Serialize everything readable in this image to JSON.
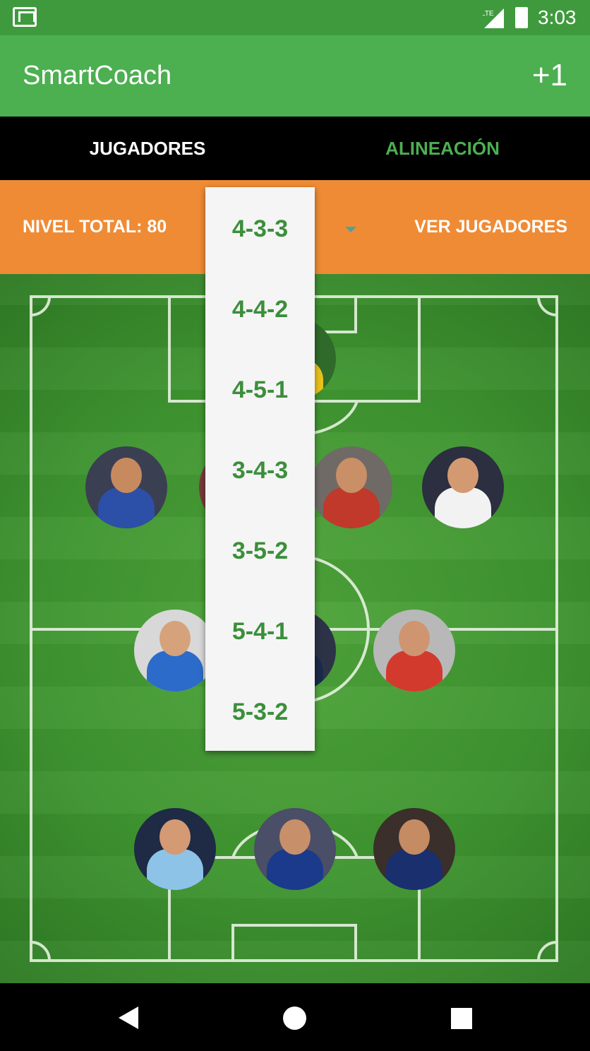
{
  "status_bar": {
    "time": "3:03",
    "network": "LTE",
    "icons": [
      "gmail-icon",
      "signal-icon",
      "battery-charging-icon"
    ]
  },
  "app_bar": {
    "title": "SmartCoach",
    "action_label": "+1"
  },
  "tabs": [
    {
      "label": "JUGADORES",
      "selected": false
    },
    {
      "label": "ALINEACIÓN",
      "selected": true
    }
  ],
  "info_bar": {
    "level_label": "NIVEL TOTAL: 80",
    "view_players_label": "VER JUGADORES"
  },
  "formation_dropdown": {
    "selected": "4-3-3",
    "options": [
      "4-3-3",
      "4-4-2",
      "4-5-1",
      "3-4-3",
      "3-5-2",
      "5-4-1",
      "5-3-2"
    ]
  },
  "colors": {
    "primary": "#4caf50",
    "status_bar": "#3f9a3d",
    "accent": "#ef8b35",
    "tab_bar": "#000000",
    "option_text": "#3b8f3b"
  },
  "players": [
    {
      "role": "goalkeeper",
      "shirt": "#e8c21b",
      "skin": "#c68a62"
    },
    {
      "role": "defender",
      "shirt": "#2c4fa8",
      "skin": "#c78a5f"
    },
    {
      "role": "defender",
      "shirt": "#c0392b",
      "skin": "#c98f66"
    },
    {
      "role": "defender",
      "shirt": "#c0392b",
      "skin": "#c98f66"
    },
    {
      "role": "defender",
      "shirt": "#f2f2f2",
      "skin": "#d39a72"
    },
    {
      "role": "midfielder",
      "shirt": "#2c6bc9",
      "skin": "#d6a27b"
    },
    {
      "role": "midfielder",
      "shirt": "#1b2a4a",
      "skin": "#b47a53"
    },
    {
      "role": "midfielder",
      "shirt": "#d33a2e",
      "skin": "#cf9570"
    },
    {
      "role": "forward",
      "shirt": "#8ec3e8",
      "skin": "#d49a73"
    },
    {
      "role": "forward",
      "shirt": "#1b3a8c",
      "skin": "#c8906a"
    },
    {
      "role": "forward",
      "shirt": "#1a2f6e",
      "skin": "#c58b62"
    }
  ],
  "nav_bar": {
    "icons": [
      "back-icon",
      "home-icon",
      "recent-apps-icon"
    ]
  }
}
